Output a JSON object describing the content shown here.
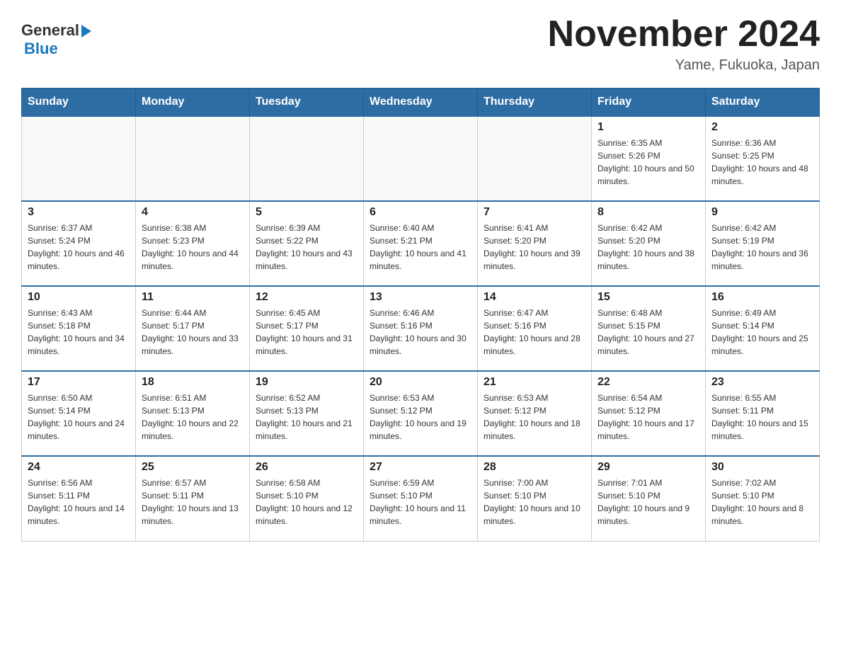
{
  "header": {
    "logo_general": "General",
    "logo_blue": "Blue",
    "month_title": "November 2024",
    "location": "Yame, Fukuoka, Japan"
  },
  "weekdays": [
    "Sunday",
    "Monday",
    "Tuesday",
    "Wednesday",
    "Thursday",
    "Friday",
    "Saturday"
  ],
  "weeks": [
    [
      {
        "day": "",
        "info": ""
      },
      {
        "day": "",
        "info": ""
      },
      {
        "day": "",
        "info": ""
      },
      {
        "day": "",
        "info": ""
      },
      {
        "day": "",
        "info": ""
      },
      {
        "day": "1",
        "info": "Sunrise: 6:35 AM\nSunset: 5:26 PM\nDaylight: 10 hours and 50 minutes."
      },
      {
        "day": "2",
        "info": "Sunrise: 6:36 AM\nSunset: 5:25 PM\nDaylight: 10 hours and 48 minutes."
      }
    ],
    [
      {
        "day": "3",
        "info": "Sunrise: 6:37 AM\nSunset: 5:24 PM\nDaylight: 10 hours and 46 minutes."
      },
      {
        "day": "4",
        "info": "Sunrise: 6:38 AM\nSunset: 5:23 PM\nDaylight: 10 hours and 44 minutes."
      },
      {
        "day": "5",
        "info": "Sunrise: 6:39 AM\nSunset: 5:22 PM\nDaylight: 10 hours and 43 minutes."
      },
      {
        "day": "6",
        "info": "Sunrise: 6:40 AM\nSunset: 5:21 PM\nDaylight: 10 hours and 41 minutes."
      },
      {
        "day": "7",
        "info": "Sunrise: 6:41 AM\nSunset: 5:20 PM\nDaylight: 10 hours and 39 minutes."
      },
      {
        "day": "8",
        "info": "Sunrise: 6:42 AM\nSunset: 5:20 PM\nDaylight: 10 hours and 38 minutes."
      },
      {
        "day": "9",
        "info": "Sunrise: 6:42 AM\nSunset: 5:19 PM\nDaylight: 10 hours and 36 minutes."
      }
    ],
    [
      {
        "day": "10",
        "info": "Sunrise: 6:43 AM\nSunset: 5:18 PM\nDaylight: 10 hours and 34 minutes."
      },
      {
        "day": "11",
        "info": "Sunrise: 6:44 AM\nSunset: 5:17 PM\nDaylight: 10 hours and 33 minutes."
      },
      {
        "day": "12",
        "info": "Sunrise: 6:45 AM\nSunset: 5:17 PM\nDaylight: 10 hours and 31 minutes."
      },
      {
        "day": "13",
        "info": "Sunrise: 6:46 AM\nSunset: 5:16 PM\nDaylight: 10 hours and 30 minutes."
      },
      {
        "day": "14",
        "info": "Sunrise: 6:47 AM\nSunset: 5:16 PM\nDaylight: 10 hours and 28 minutes."
      },
      {
        "day": "15",
        "info": "Sunrise: 6:48 AM\nSunset: 5:15 PM\nDaylight: 10 hours and 27 minutes."
      },
      {
        "day": "16",
        "info": "Sunrise: 6:49 AM\nSunset: 5:14 PM\nDaylight: 10 hours and 25 minutes."
      }
    ],
    [
      {
        "day": "17",
        "info": "Sunrise: 6:50 AM\nSunset: 5:14 PM\nDaylight: 10 hours and 24 minutes."
      },
      {
        "day": "18",
        "info": "Sunrise: 6:51 AM\nSunset: 5:13 PM\nDaylight: 10 hours and 22 minutes."
      },
      {
        "day": "19",
        "info": "Sunrise: 6:52 AM\nSunset: 5:13 PM\nDaylight: 10 hours and 21 minutes."
      },
      {
        "day": "20",
        "info": "Sunrise: 6:53 AM\nSunset: 5:12 PM\nDaylight: 10 hours and 19 minutes."
      },
      {
        "day": "21",
        "info": "Sunrise: 6:53 AM\nSunset: 5:12 PM\nDaylight: 10 hours and 18 minutes."
      },
      {
        "day": "22",
        "info": "Sunrise: 6:54 AM\nSunset: 5:12 PM\nDaylight: 10 hours and 17 minutes."
      },
      {
        "day": "23",
        "info": "Sunrise: 6:55 AM\nSunset: 5:11 PM\nDaylight: 10 hours and 15 minutes."
      }
    ],
    [
      {
        "day": "24",
        "info": "Sunrise: 6:56 AM\nSunset: 5:11 PM\nDaylight: 10 hours and 14 minutes."
      },
      {
        "day": "25",
        "info": "Sunrise: 6:57 AM\nSunset: 5:11 PM\nDaylight: 10 hours and 13 minutes."
      },
      {
        "day": "26",
        "info": "Sunrise: 6:58 AM\nSunset: 5:10 PM\nDaylight: 10 hours and 12 minutes."
      },
      {
        "day": "27",
        "info": "Sunrise: 6:59 AM\nSunset: 5:10 PM\nDaylight: 10 hours and 11 minutes."
      },
      {
        "day": "28",
        "info": "Sunrise: 7:00 AM\nSunset: 5:10 PM\nDaylight: 10 hours and 10 minutes."
      },
      {
        "day": "29",
        "info": "Sunrise: 7:01 AM\nSunset: 5:10 PM\nDaylight: 10 hours and 9 minutes."
      },
      {
        "day": "30",
        "info": "Sunrise: 7:02 AM\nSunset: 5:10 PM\nDaylight: 10 hours and 8 minutes."
      }
    ]
  ]
}
